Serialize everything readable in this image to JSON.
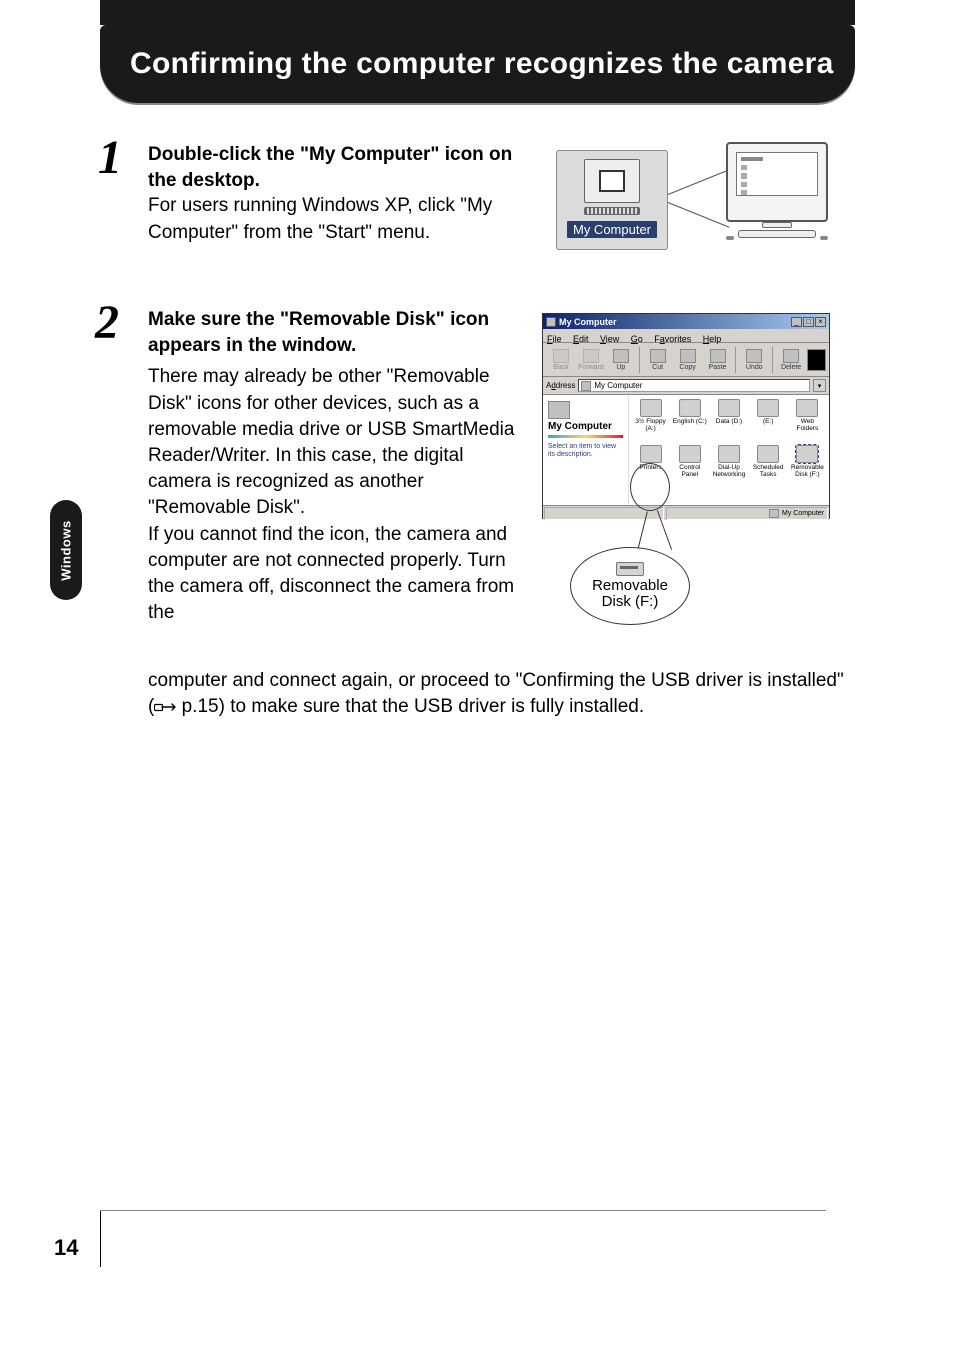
{
  "header": {
    "title": "Confirming the computer recognizes the camera"
  },
  "side_tab": "Windows",
  "page_number": "14",
  "step1": {
    "num": "1",
    "head": "Double-click the \"My Computer\" icon on the desktop.",
    "text": "For users running Windows XP, click \"My Computer\" from the \"Start\" menu.",
    "icon_label": "My Computer"
  },
  "step2": {
    "num": "2",
    "head": "Make sure the \"Removable Disk\" icon appears in the window.",
    "text_a": "There may already be other \"Removable Disk\" icons for other devices, such as a removable media drive or USB SmartMedia Reader/Writer. In this case, the digital camera is recognized as another \"Removable Disk\".",
    "text_b": "If you cannot find the icon, the camera and computer are not connected properly. Turn the camera off, disconnect the camera from the",
    "text_c_pre": "computer and connect again, or proceed to \"Confirming the USB driver is installed\" (",
    "page_ref": " p.15",
    "text_c_post": ") to make sure that the USB driver is fully installed."
  },
  "win": {
    "title": "My Computer",
    "menu": {
      "file": "File",
      "edit": "Edit",
      "view": "View",
      "go": "Go",
      "fav": "Favorites",
      "help": "Help"
    },
    "tb": {
      "back": "Back",
      "forward": "Forward",
      "up": "Up",
      "cut": "Cut",
      "copy": "Copy",
      "paste": "Paste",
      "undo": "Undo",
      "delete": "Delete"
    },
    "addr_label": "Address",
    "addr_value": "My Computer",
    "left_title": "My Computer",
    "left_desc": "Select an item to view its description.",
    "icons": {
      "floppy": "3½ Floppy (A:)",
      "english": "English (C:)",
      "data": "Data (D:)",
      "e": "(E:)",
      "web": "Web Folders",
      "printers": "Printers",
      "cpanel": "Control Panel",
      "dun": "Dial-Up Networking",
      "tasks": "Scheduled Tasks",
      "removable": "Removable Disk (F:)"
    },
    "status": "My Computer"
  },
  "callout": {
    "line1": "Removable",
    "line2": "Disk (F:)"
  }
}
